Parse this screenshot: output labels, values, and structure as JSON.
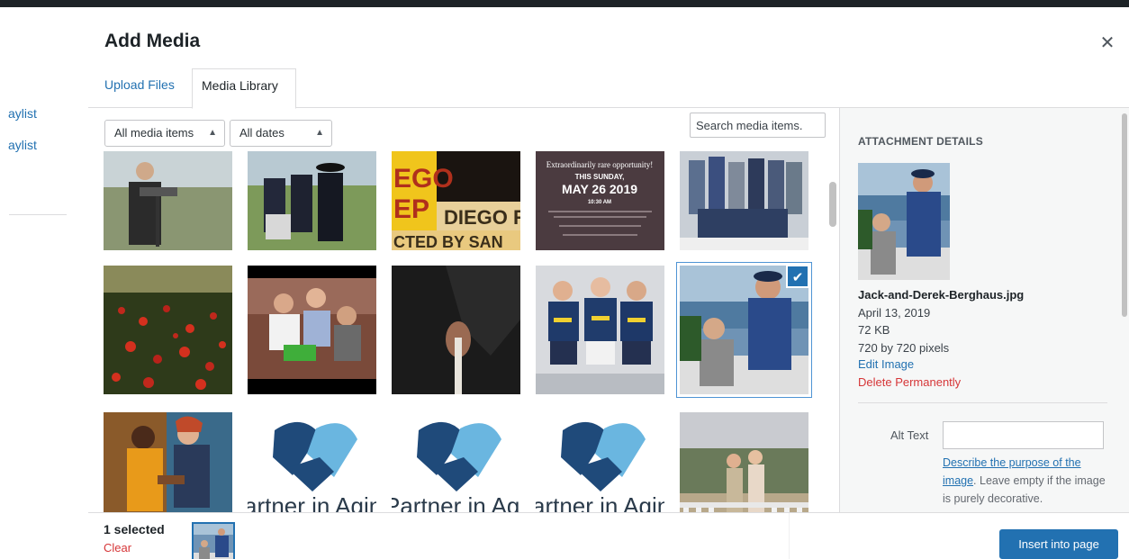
{
  "background": {
    "links": [
      "aylist",
      "aylist"
    ]
  },
  "modal": {
    "title": "Add Media",
    "close_icon": "close-icon"
  },
  "tabs": {
    "upload": "Upload Files",
    "library": "Media Library"
  },
  "toolbar": {
    "type_filter": "All media items",
    "date_filter": "All dates",
    "search_placeholder": "Search media items."
  },
  "grid": {
    "items": [
      {
        "alt": "Speaker at podium outdoors"
      },
      {
        "alt": "Men in suits and hats on lawn"
      },
      {
        "alt": "San Diego Rep theater marquee"
      },
      {
        "alt": "Event flyer",
        "text": {
          "line1": "Extraordinarily rare opportunity!",
          "line2": "THIS SUNDAY,",
          "line3": "MAY 26 2019",
          "line4": "10:30 AM"
        }
      },
      {
        "alt": "Group photo indoors"
      },
      {
        "alt": "Field of red poppies"
      },
      {
        "alt": "Family on couch"
      },
      {
        "alt": "Hands holding a cane"
      },
      {
        "alt": "Three men in matching t-shirts"
      },
      {
        "alt": "Jack and Derek by the ocean",
        "selected": true
      },
      {
        "alt": "Two women with guitar"
      },
      {
        "alt": "Partner in Aging logo",
        "text": "artner in Agin"
      },
      {
        "alt": "Partner in Aging logo",
        "text": "Partner in Aging"
      },
      {
        "alt": "Partner in Aging logo",
        "text": "artner in Agin"
      },
      {
        "alt": "Couple on terrace"
      }
    ]
  },
  "details": {
    "heading": "ATTACHMENT DETAILS",
    "filename": "Jack-and-Derek-Berghaus.jpg",
    "date": "April 13, 2019",
    "size": "72 KB",
    "dimensions": "720 by 720 pixels",
    "edit_link": "Edit Image",
    "delete_link": "Delete Permanently",
    "alt_label": "Alt Text",
    "alt_value": "",
    "alt_help_link": "Describe the purpose of the image",
    "alt_help_rest": ". Leave empty if the image is purely decorative."
  },
  "footer": {
    "selected_count": "1 selected",
    "clear": "Clear",
    "insert_button": "Insert into page"
  },
  "colors": {
    "accent": "#2271b1",
    "danger": "#d63638",
    "admin_bar": "#1d2327"
  }
}
